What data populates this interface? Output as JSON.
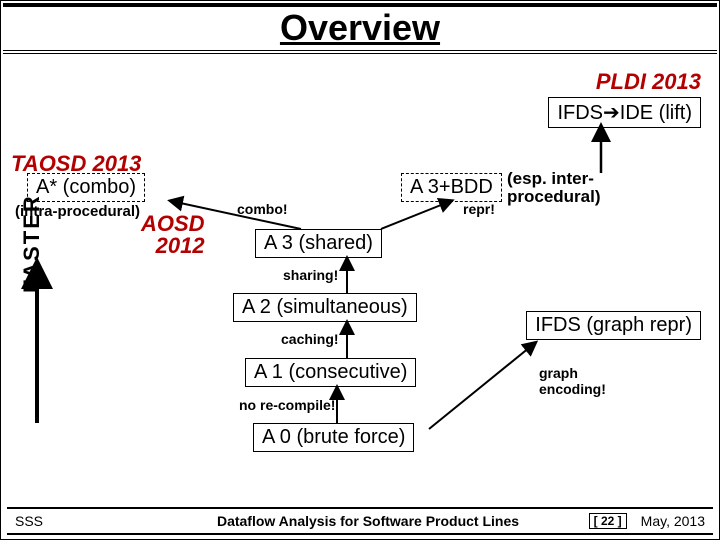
{
  "title": "Overview",
  "badges": {
    "pldi": "PLDI 2013",
    "taosd": "TAOSD 2013",
    "aosd_line1": "AOSD",
    "aosd_line2": "2012"
  },
  "boxes": {
    "ifds_ide": "IFDS➔IDE (lift)",
    "astar": "A* (combo)",
    "a3bdd": "A 3+BDD",
    "a3": "A 3 (shared)",
    "a2": "A 2 (simultaneous)",
    "a1": "A 1 (consecutive)",
    "a0": "A 0 (brute force)",
    "ifds_graph": "IFDS (graph repr)"
  },
  "annots": {
    "intra": "(intra-procedural)",
    "combo": "combo!",
    "repr": "repr!",
    "sharing": "sharing!",
    "caching": "caching!",
    "no_recompile": "no re-compile!",
    "graph_enc1": "graph",
    "graph_enc2": "encoding!",
    "esp1": "(esp. inter-",
    "esp2": "procedural)"
  },
  "faster_label": "FASTER",
  "footer": {
    "left": "SSS",
    "center": "Dataflow Analysis for Software Product Lines",
    "page": "[ 22 ]",
    "right": "May, 2013"
  }
}
